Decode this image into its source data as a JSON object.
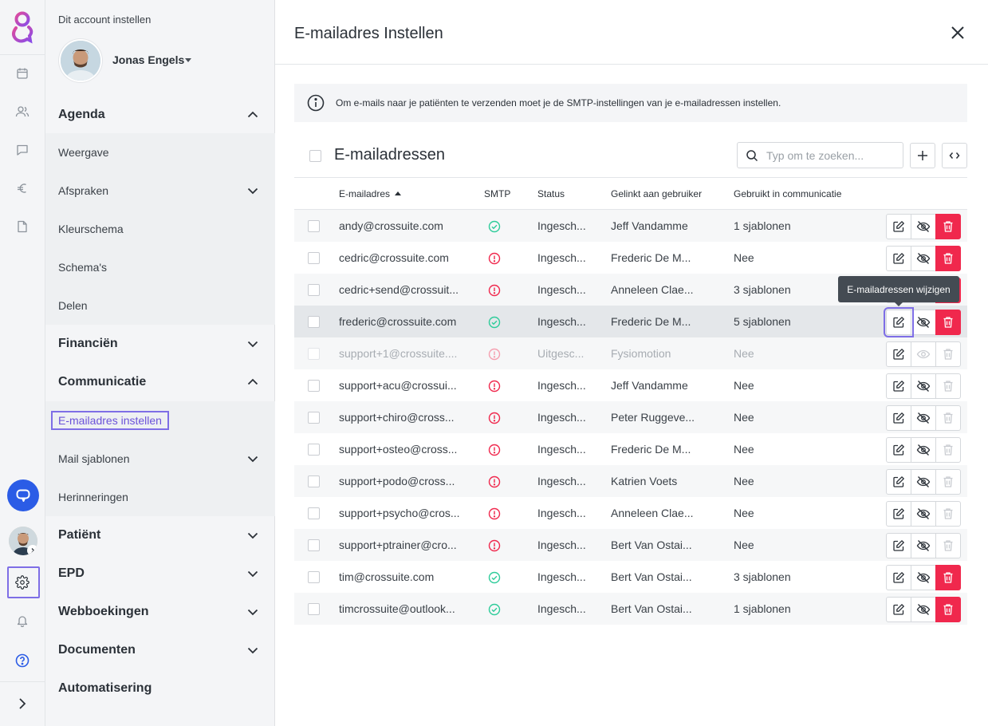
{
  "colors": {
    "accent": "#7e6ee6",
    "danger": "#f0284d",
    "success": "#2ecc9a",
    "warning": "#f0284d",
    "chat": "#2b5ce6",
    "logo": "#b84bd8"
  },
  "sidebar": {
    "account_label": "Dit account instellen",
    "user_name": "Jonas Engels",
    "items": [
      {
        "label": "Agenda",
        "head": true,
        "chevron": "up"
      },
      {
        "label": "Weergave",
        "head": false,
        "chevron": ""
      },
      {
        "label": "Afspraken",
        "head": false,
        "chevron": "down"
      },
      {
        "label": "Kleurschema",
        "head": false,
        "chevron": ""
      },
      {
        "label": "Schema's",
        "head": false,
        "chevron": ""
      },
      {
        "label": "Delen",
        "head": false,
        "chevron": ""
      },
      {
        "label": "Financiën",
        "head": true,
        "chevron": "down"
      },
      {
        "label": "Communicatie",
        "head": true,
        "chevron": "up"
      },
      {
        "label": "E-mailadres instellen",
        "head": false,
        "chevron": "",
        "active": true
      },
      {
        "label": "Mail sjablonen",
        "head": false,
        "chevron": "down"
      },
      {
        "label": "Herinneringen",
        "head": false,
        "chevron": ""
      },
      {
        "label": "Patiënt",
        "head": true,
        "chevron": "down"
      },
      {
        "label": "EPD",
        "head": true,
        "chevron": "down"
      },
      {
        "label": "Webboekingen",
        "head": true,
        "chevron": "down"
      },
      {
        "label": "Documenten",
        "head": true,
        "chevron": "down"
      },
      {
        "label": "Automatisering",
        "head": true,
        "chevron": ""
      }
    ]
  },
  "rail": {
    "icons": [
      "calendar-icon",
      "users-icon",
      "message-icon",
      "euro-icon",
      "document-icon"
    ],
    "bottom_icons": [
      "chat-bubble-icon",
      "gear-icon",
      "bell-icon",
      "help-icon",
      "expand-icon"
    ]
  },
  "main": {
    "title": "E-mailadres Instellen",
    "info_text": "Om e-mails naar je patiënten te verzenden moet je de SMTP-instellingen van je e-mailadressen instellen.",
    "section_title": "E-mailadressen",
    "search_placeholder": "Typ om te zoeken...",
    "tooltip": "E-mailadressen wijzigen",
    "columns": [
      "E-mailadres",
      "SMTP",
      "Status",
      "Gelinkt aan gebruiker",
      "Gebruikt in communicatie"
    ],
    "rows": [
      {
        "email": "andy@crossuite.com",
        "smtp": "ok",
        "status": "Ingesch...",
        "user": "Jeff Vandamme",
        "usage": "1 sjablonen",
        "visible": true,
        "deletable": true
      },
      {
        "email": "cedric@crossuite.com",
        "smtp": "error",
        "status": "Ingesch...",
        "user": "Frederic De M...",
        "usage": "Nee",
        "visible": true,
        "deletable": true
      },
      {
        "email": "cedric+send@crossuit...",
        "smtp": "error",
        "status": "Ingesch...",
        "user": "Anneleen Clae...",
        "usage": "3 sjablonen",
        "visible": true,
        "deletable": true
      },
      {
        "email": "frederic@crossuite.com",
        "smtp": "ok",
        "status": "Ingesch...",
        "user": "Frederic De M...",
        "usage": "5 sjablonen",
        "visible": true,
        "deletable": true
      },
      {
        "email": "support+1@crossuite....",
        "smtp": "error",
        "status": "Uitgesc...",
        "user": "Fysiomotion",
        "usage": "Nee",
        "visible": false,
        "deletable": false,
        "disabled": true
      },
      {
        "email": "support+acu@crossui...",
        "smtp": "error",
        "status": "Ingesch...",
        "user": "Jeff Vandamme",
        "usage": "Nee",
        "visible": true,
        "deletable": false
      },
      {
        "email": "support+chiro@cross...",
        "smtp": "error",
        "status": "Ingesch...",
        "user": "Peter Ruggeve...",
        "usage": "Nee",
        "visible": true,
        "deletable": false
      },
      {
        "email": "support+osteo@cross...",
        "smtp": "error",
        "status": "Ingesch...",
        "user": "Frederic De M...",
        "usage": "Nee",
        "visible": true,
        "deletable": false
      },
      {
        "email": "support+podo@cross...",
        "smtp": "error",
        "status": "Ingesch...",
        "user": "Katrien Voets",
        "usage": "Nee",
        "visible": true,
        "deletable": false
      },
      {
        "email": "support+psycho@cros...",
        "smtp": "error",
        "status": "Ingesch...",
        "user": "Anneleen Clae...",
        "usage": "Nee",
        "visible": true,
        "deletable": false
      },
      {
        "email": "support+ptrainer@cro...",
        "smtp": "error",
        "status": "Ingesch...",
        "user": "Bert Van Ostai...",
        "usage": "Nee",
        "visible": true,
        "deletable": false
      },
      {
        "email": "tim@crossuite.com",
        "smtp": "ok",
        "status": "Ingesch...",
        "user": "Bert Van Ostai...",
        "usage": "3 sjablonen",
        "visible": true,
        "deletable": true
      },
      {
        "email": "timcrossuite@outlook...",
        "smtp": "ok",
        "status": "Ingesch...",
        "user": "Bert Van Ostai...",
        "usage": "1 sjablonen",
        "visible": true,
        "deletable": true
      }
    ]
  }
}
